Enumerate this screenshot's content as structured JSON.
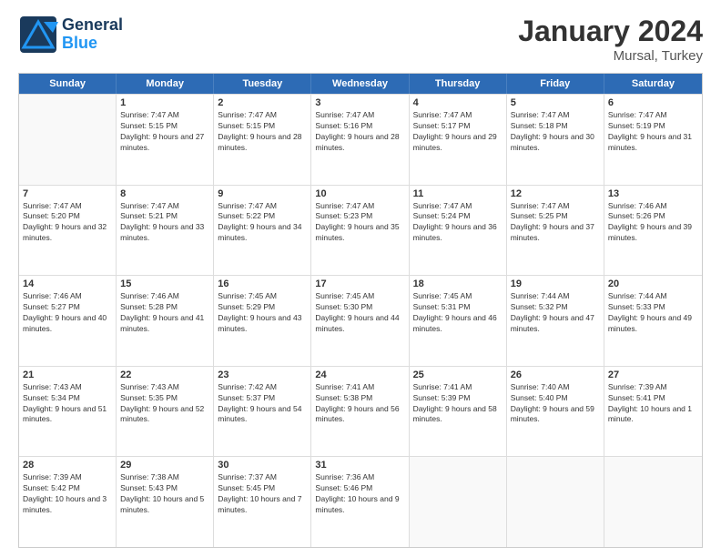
{
  "header": {
    "logo_general": "General",
    "logo_blue": "Blue",
    "title": "January 2024",
    "location": "Mursal, Turkey"
  },
  "weekdays": [
    "Sunday",
    "Monday",
    "Tuesday",
    "Wednesday",
    "Thursday",
    "Friday",
    "Saturday"
  ],
  "weeks": [
    [
      {
        "day": "",
        "sunrise": "",
        "sunset": "",
        "daylight": ""
      },
      {
        "day": "1",
        "sunrise": "Sunrise: 7:47 AM",
        "sunset": "Sunset: 5:15 PM",
        "daylight": "Daylight: 9 hours and 27 minutes."
      },
      {
        "day": "2",
        "sunrise": "Sunrise: 7:47 AM",
        "sunset": "Sunset: 5:15 PM",
        "daylight": "Daylight: 9 hours and 28 minutes."
      },
      {
        "day": "3",
        "sunrise": "Sunrise: 7:47 AM",
        "sunset": "Sunset: 5:16 PM",
        "daylight": "Daylight: 9 hours and 28 minutes."
      },
      {
        "day": "4",
        "sunrise": "Sunrise: 7:47 AM",
        "sunset": "Sunset: 5:17 PM",
        "daylight": "Daylight: 9 hours and 29 minutes."
      },
      {
        "day": "5",
        "sunrise": "Sunrise: 7:47 AM",
        "sunset": "Sunset: 5:18 PM",
        "daylight": "Daylight: 9 hours and 30 minutes."
      },
      {
        "day": "6",
        "sunrise": "Sunrise: 7:47 AM",
        "sunset": "Sunset: 5:19 PM",
        "daylight": "Daylight: 9 hours and 31 minutes."
      }
    ],
    [
      {
        "day": "7",
        "sunrise": "Sunrise: 7:47 AM",
        "sunset": "Sunset: 5:20 PM",
        "daylight": "Daylight: 9 hours and 32 minutes."
      },
      {
        "day": "8",
        "sunrise": "Sunrise: 7:47 AM",
        "sunset": "Sunset: 5:21 PM",
        "daylight": "Daylight: 9 hours and 33 minutes."
      },
      {
        "day": "9",
        "sunrise": "Sunrise: 7:47 AM",
        "sunset": "Sunset: 5:22 PM",
        "daylight": "Daylight: 9 hours and 34 minutes."
      },
      {
        "day": "10",
        "sunrise": "Sunrise: 7:47 AM",
        "sunset": "Sunset: 5:23 PM",
        "daylight": "Daylight: 9 hours and 35 minutes."
      },
      {
        "day": "11",
        "sunrise": "Sunrise: 7:47 AM",
        "sunset": "Sunset: 5:24 PM",
        "daylight": "Daylight: 9 hours and 36 minutes."
      },
      {
        "day": "12",
        "sunrise": "Sunrise: 7:47 AM",
        "sunset": "Sunset: 5:25 PM",
        "daylight": "Daylight: 9 hours and 37 minutes."
      },
      {
        "day": "13",
        "sunrise": "Sunrise: 7:46 AM",
        "sunset": "Sunset: 5:26 PM",
        "daylight": "Daylight: 9 hours and 39 minutes."
      }
    ],
    [
      {
        "day": "14",
        "sunrise": "Sunrise: 7:46 AM",
        "sunset": "Sunset: 5:27 PM",
        "daylight": "Daylight: 9 hours and 40 minutes."
      },
      {
        "day": "15",
        "sunrise": "Sunrise: 7:46 AM",
        "sunset": "Sunset: 5:28 PM",
        "daylight": "Daylight: 9 hours and 41 minutes."
      },
      {
        "day": "16",
        "sunrise": "Sunrise: 7:45 AM",
        "sunset": "Sunset: 5:29 PM",
        "daylight": "Daylight: 9 hours and 43 minutes."
      },
      {
        "day": "17",
        "sunrise": "Sunrise: 7:45 AM",
        "sunset": "Sunset: 5:30 PM",
        "daylight": "Daylight: 9 hours and 44 minutes."
      },
      {
        "day": "18",
        "sunrise": "Sunrise: 7:45 AM",
        "sunset": "Sunset: 5:31 PM",
        "daylight": "Daylight: 9 hours and 46 minutes."
      },
      {
        "day": "19",
        "sunrise": "Sunrise: 7:44 AM",
        "sunset": "Sunset: 5:32 PM",
        "daylight": "Daylight: 9 hours and 47 minutes."
      },
      {
        "day": "20",
        "sunrise": "Sunrise: 7:44 AM",
        "sunset": "Sunset: 5:33 PM",
        "daylight": "Daylight: 9 hours and 49 minutes."
      }
    ],
    [
      {
        "day": "21",
        "sunrise": "Sunrise: 7:43 AM",
        "sunset": "Sunset: 5:34 PM",
        "daylight": "Daylight: 9 hours and 51 minutes."
      },
      {
        "day": "22",
        "sunrise": "Sunrise: 7:43 AM",
        "sunset": "Sunset: 5:35 PM",
        "daylight": "Daylight: 9 hours and 52 minutes."
      },
      {
        "day": "23",
        "sunrise": "Sunrise: 7:42 AM",
        "sunset": "Sunset: 5:37 PM",
        "daylight": "Daylight: 9 hours and 54 minutes."
      },
      {
        "day": "24",
        "sunrise": "Sunrise: 7:41 AM",
        "sunset": "Sunset: 5:38 PM",
        "daylight": "Daylight: 9 hours and 56 minutes."
      },
      {
        "day": "25",
        "sunrise": "Sunrise: 7:41 AM",
        "sunset": "Sunset: 5:39 PM",
        "daylight": "Daylight: 9 hours and 58 minutes."
      },
      {
        "day": "26",
        "sunrise": "Sunrise: 7:40 AM",
        "sunset": "Sunset: 5:40 PM",
        "daylight": "Daylight: 9 hours and 59 minutes."
      },
      {
        "day": "27",
        "sunrise": "Sunrise: 7:39 AM",
        "sunset": "Sunset: 5:41 PM",
        "daylight": "Daylight: 10 hours and 1 minute."
      }
    ],
    [
      {
        "day": "28",
        "sunrise": "Sunrise: 7:39 AM",
        "sunset": "Sunset: 5:42 PM",
        "daylight": "Daylight: 10 hours and 3 minutes."
      },
      {
        "day": "29",
        "sunrise": "Sunrise: 7:38 AM",
        "sunset": "Sunset: 5:43 PM",
        "daylight": "Daylight: 10 hours and 5 minutes."
      },
      {
        "day": "30",
        "sunrise": "Sunrise: 7:37 AM",
        "sunset": "Sunset: 5:45 PM",
        "daylight": "Daylight: 10 hours and 7 minutes."
      },
      {
        "day": "31",
        "sunrise": "Sunrise: 7:36 AM",
        "sunset": "Sunset: 5:46 PM",
        "daylight": "Daylight: 10 hours and 9 minutes."
      },
      {
        "day": "",
        "sunrise": "",
        "sunset": "",
        "daylight": ""
      },
      {
        "day": "",
        "sunrise": "",
        "sunset": "",
        "daylight": ""
      },
      {
        "day": "",
        "sunrise": "",
        "sunset": "",
        "daylight": ""
      }
    ]
  ]
}
